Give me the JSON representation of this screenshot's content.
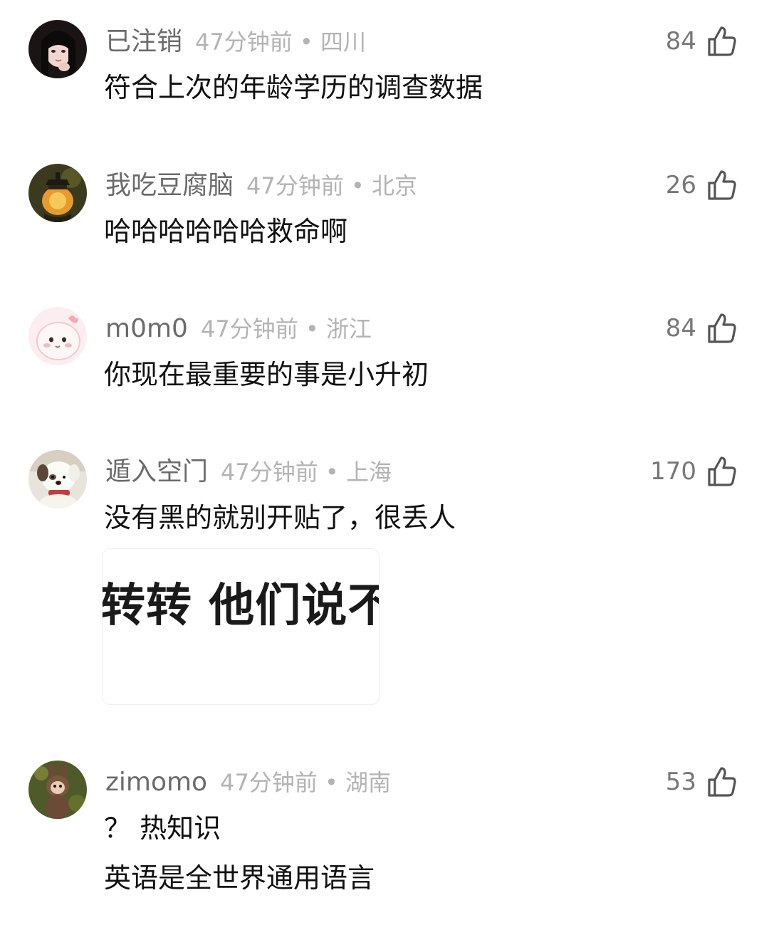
{
  "comments": [
    {
      "username": "已注销",
      "time_location": "47分钟前 • 四川",
      "likes": "84",
      "lines": [
        "符合上次的年龄学历的调查数据"
      ],
      "avatar_icon": "girl-portrait-avatar"
    },
    {
      "username": "我吃豆腐脑",
      "time_location": "47分钟前 • 北京",
      "likes": "26",
      "lines": [
        "哈哈哈哈哈哈救命啊"
      ],
      "avatar_icon": "lantern-avatar"
    },
    {
      "username": "m0m0",
      "time_location": "47分钟前 • 浙江",
      "likes": "84",
      "lines": [
        "你现在最重要的事是小升初"
      ],
      "avatar_icon": "pink-cartoon-avatar"
    },
    {
      "username": "遁入空门",
      "time_location": "47分钟前 • 上海",
      "likes": "170",
      "lines": [
        "没有黑的就别开贴了，很丢人"
      ],
      "sticker_text": "转转 他们说不",
      "avatar_icon": "plush-dog-avatar"
    },
    {
      "username": "zimomo",
      "time_location": "47分钟前 • 湖南",
      "likes": "53",
      "lines": [
        "？ 热知识",
        "英语是全世界通用语言"
      ],
      "avatar_icon": "labubu-doll-avatar"
    }
  ],
  "colors": {
    "username": "#6b6b6b",
    "meta": "#b3b3b3",
    "text": "#111111",
    "like_icon": "#555555"
  }
}
